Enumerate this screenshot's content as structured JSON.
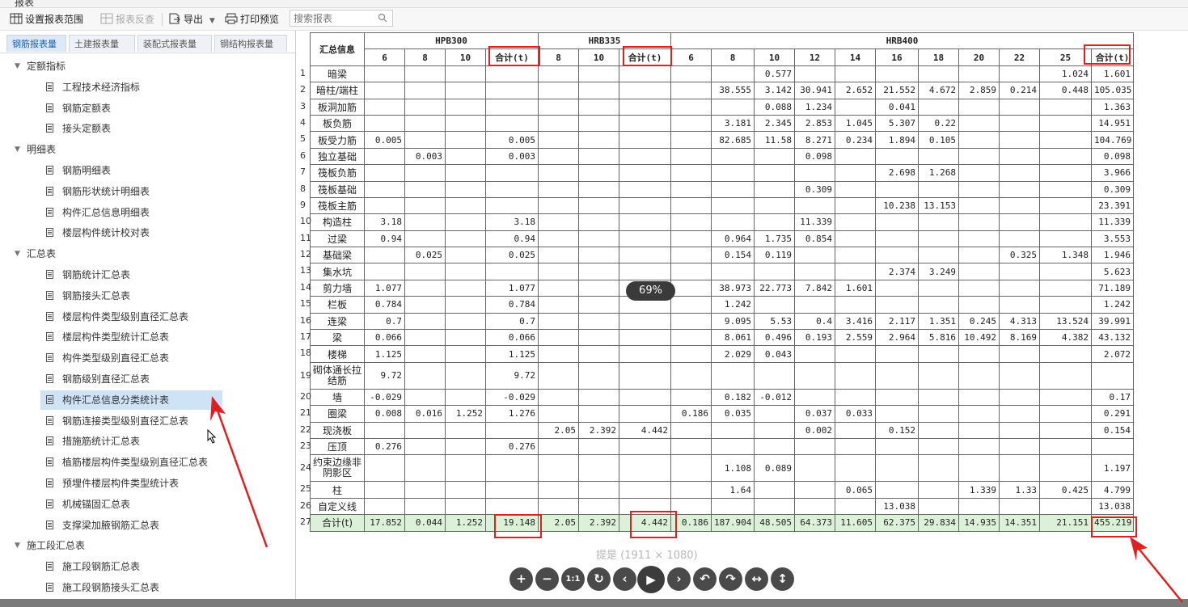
{
  "window": {
    "title": "报表"
  },
  "toolbar": {
    "set_range": "设置报表范围",
    "report_check": "报表反查",
    "export": "导出",
    "print_preview": "打印预览",
    "search_placeholder": "搜索报表"
  },
  "tabs": [
    {
      "label": "钢筋报表量",
      "active": true
    },
    {
      "label": "土建报表量",
      "active": false
    },
    {
      "label": "装配式报表量",
      "active": false
    },
    {
      "label": "钢结构报表量",
      "active": false
    }
  ],
  "tree": [
    {
      "type": "group",
      "label": "定额指标"
    },
    {
      "type": "leaf",
      "label": "工程技术经济指标"
    },
    {
      "type": "leaf",
      "label": "钢筋定额表"
    },
    {
      "type": "leaf",
      "label": "接头定额表"
    },
    {
      "type": "group",
      "label": "明细表"
    },
    {
      "type": "leaf",
      "label": "钢筋明细表"
    },
    {
      "type": "leaf",
      "label": "钢筋形状统计明细表"
    },
    {
      "type": "leaf",
      "label": "构件汇总信息明细表"
    },
    {
      "type": "leaf",
      "label": "楼层构件统计校对表"
    },
    {
      "type": "group",
      "label": "汇总表"
    },
    {
      "type": "leaf",
      "label": "钢筋统计汇总表"
    },
    {
      "type": "leaf",
      "label": "钢筋接头汇总表"
    },
    {
      "type": "leaf",
      "label": "楼层构件类型级别直径汇总表"
    },
    {
      "type": "leaf",
      "label": "楼层构件类型统计汇总表"
    },
    {
      "type": "leaf",
      "label": "构件类型级别直径汇总表"
    },
    {
      "type": "leaf",
      "label": "钢筋级别直径汇总表"
    },
    {
      "type": "leaf",
      "label": "构件汇总信息分类统计表",
      "selected": true
    },
    {
      "type": "leaf",
      "label": "钢筋连接类型级别直径汇总表"
    },
    {
      "type": "leaf",
      "label": "措施筋统计汇总表"
    },
    {
      "type": "leaf",
      "label": "植筋楼层构件类型级别直径汇总表"
    },
    {
      "type": "leaf",
      "label": "预埋件楼层构件类型统计表"
    },
    {
      "type": "leaf",
      "label": "机械锚固汇总表"
    },
    {
      "type": "leaf",
      "label": "支撑梁加腋钢筋汇总表"
    },
    {
      "type": "group",
      "label": "施工段汇总表"
    },
    {
      "type": "leaf",
      "label": "施工段钢筋汇总表"
    },
    {
      "type": "leaf",
      "label": "施工段钢筋接头汇总表"
    }
  ],
  "report": {
    "corner_header": "汇总信息",
    "groups": [
      {
        "name": "HPB300",
        "span": 4
      },
      {
        "name": "HRB335",
        "span": 3
      },
      {
        "name": "HRB400",
        "span": 11
      }
    ],
    "columns": [
      "6",
      "8",
      "10",
      "合计(t)",
      "8",
      "10",
      "合计(t)",
      "6",
      "8",
      "10",
      "12",
      "14",
      "16",
      "18",
      "20",
      "22",
      "25",
      "合计(t)"
    ],
    "rows": [
      {
        "n": "1",
        "name": "暗梁",
        "v": [
          "",
          "",
          "",
          "",
          "",
          "",
          "",
          "",
          "",
          "0.577",
          "",
          "",
          "",
          "",
          "",
          "",
          "1.024",
          "1.601"
        ]
      },
      {
        "n": "2",
        "name": "暗柱/端柱",
        "v": [
          "",
          "",
          "",
          "",
          "",
          "",
          "",
          "",
          "38.555",
          "3.142",
          "30.941",
          "2.652",
          "21.552",
          "4.672",
          "2.859",
          "0.214",
          "0.448",
          "105.035"
        ]
      },
      {
        "n": "3",
        "name": "板洞加筋",
        "v": [
          "",
          "",
          "",
          "",
          "",
          "",
          "",
          "",
          "",
          "0.088",
          "1.234",
          "",
          "0.041",
          "",
          "",
          "",
          "",
          "1.363"
        ]
      },
      {
        "n": "4",
        "name": "板负筋",
        "v": [
          "",
          "",
          "",
          "",
          "",
          "",
          "",
          "",
          "3.181",
          "2.345",
          "2.853",
          "1.045",
          "5.307",
          "0.22",
          "",
          "",
          "",
          "14.951"
        ]
      },
      {
        "n": "5",
        "name": "板受力筋",
        "v": [
          "0.005",
          "",
          "",
          "0.005",
          "",
          "",
          "",
          "",
          "82.685",
          "11.58",
          "8.271",
          "0.234",
          "1.894",
          "0.105",
          "",
          "",
          "",
          "104.769"
        ]
      },
      {
        "n": "6",
        "name": "独立基础",
        "v": [
          "",
          "0.003",
          "",
          "0.003",
          "",
          "",
          "",
          "",
          "",
          "",
          "0.098",
          "",
          "",
          "",
          "",
          "",
          "",
          "0.098"
        ]
      },
      {
        "n": "7",
        "name": "筏板负筋",
        "v": [
          "",
          "",
          "",
          "",
          "",
          "",
          "",
          "",
          "",
          "",
          "",
          "",
          "2.698",
          "1.268",
          "",
          "",
          "",
          "3.966"
        ]
      },
      {
        "n": "8",
        "name": "筏板基础",
        "v": [
          "",
          "",
          "",
          "",
          "",
          "",
          "",
          "",
          "",
          "",
          "0.309",
          "",
          "",
          "",
          "",
          "",
          "",
          "0.309"
        ]
      },
      {
        "n": "9",
        "name": "筏板主筋",
        "v": [
          "",
          "",
          "",
          "",
          "",
          "",
          "",
          "",
          "",
          "",
          "",
          "",
          "10.238",
          "13.153",
          "",
          "",
          "",
          "23.391"
        ]
      },
      {
        "n": "10",
        "name": "构造柱",
        "v": [
          "3.18",
          "",
          "",
          "3.18",
          "",
          "",
          "",
          "",
          "",
          "",
          "11.339",
          "",
          "",
          "",
          "",
          "",
          "",
          "11.339"
        ]
      },
      {
        "n": "11",
        "name": "过梁",
        "v": [
          "0.94",
          "",
          "",
          "0.94",
          "",
          "",
          "",
          "",
          "0.964",
          "1.735",
          "0.854",
          "",
          "",
          "",
          "",
          "",
          "",
          "3.553"
        ]
      },
      {
        "n": "12",
        "name": "基础梁",
        "v": [
          "",
          "0.025",
          "",
          "0.025",
          "",
          "",
          "",
          "",
          "0.154",
          "0.119",
          "",
          "",
          "",
          "",
          "",
          "0.325",
          "1.348",
          "1.946"
        ]
      },
      {
        "n": "13",
        "name": "集水坑",
        "v": [
          "",
          "",
          "",
          "",
          "",
          "",
          "",
          "",
          "",
          "",
          "",
          "",
          "2.374",
          "3.249",
          "",
          "",
          "",
          "5.623"
        ]
      },
      {
        "n": "14",
        "name": "剪力墙",
        "v": [
          "1.077",
          "",
          "",
          "1.077",
          "",
          "",
          "",
          "",
          "38.973",
          "22.773",
          "7.842",
          "1.601",
          "",
          "",
          "",
          "",
          "",
          "71.189"
        ]
      },
      {
        "n": "15",
        "name": "栏板",
        "v": [
          "0.784",
          "",
          "",
          "0.784",
          "",
          "",
          "",
          "",
          "1.242",
          "",
          "",
          "",
          "",
          "",
          "",
          "",
          "",
          "1.242"
        ]
      },
      {
        "n": "16",
        "name": "连梁",
        "v": [
          "0.7",
          "",
          "",
          "0.7",
          "",
          "",
          "",
          "",
          "9.095",
          "5.53",
          "0.4",
          "3.416",
          "2.117",
          "1.351",
          "0.245",
          "4.313",
          "13.524",
          "39.991"
        ]
      },
      {
        "n": "17",
        "name": "梁",
        "v": [
          "0.066",
          "",
          "",
          "0.066",
          "",
          "",
          "",
          "",
          "8.061",
          "0.496",
          "0.193",
          "2.559",
          "2.964",
          "5.816",
          "10.492",
          "8.169",
          "4.382",
          "43.132"
        ]
      },
      {
        "n": "18",
        "name": "楼梯",
        "v": [
          "1.125",
          "",
          "",
          "1.125",
          "",
          "",
          "",
          "",
          "2.029",
          "0.043",
          "",
          "",
          "",
          "",
          "",
          "",
          "",
          "2.072"
        ]
      },
      {
        "n": "19",
        "name": "砌体通长拉结筋",
        "v": [
          "9.72",
          "",
          "",
          "9.72",
          "",
          "",
          "",
          "",
          "",
          "",
          "",
          "",
          "",
          "",
          "",
          "",
          "",
          ""
        ],
        "tall": true
      },
      {
        "n": "20",
        "name": "墙",
        "v": [
          "-0.029",
          "",
          "",
          "-0.029",
          "",
          "",
          "",
          "",
          "0.182",
          "-0.012",
          "",
          "",
          "",
          "",
          "",
          "",
          "",
          "0.17"
        ]
      },
      {
        "n": "21",
        "name": "圈梁",
        "v": [
          "0.008",
          "0.016",
          "1.252",
          "1.276",
          "",
          "",
          "",
          "0.186",
          "0.035",
          "",
          "0.037",
          "0.033",
          "",
          "",
          "",
          "",
          "",
          "0.291"
        ]
      },
      {
        "n": "22",
        "name": "现浇板",
        "v": [
          "",
          "",
          "",
          "",
          "2.05",
          "2.392",
          "4.442",
          "",
          "",
          "",
          "0.002",
          "",
          "0.152",
          "",
          "",
          "",
          "",
          "0.154"
        ]
      },
      {
        "n": "23",
        "name": "压顶",
        "v": [
          "0.276",
          "",
          "",
          "0.276",
          "",
          "",
          "",
          "",
          "",
          "",
          "",
          "",
          "",
          "",
          "",
          "",
          "",
          ""
        ]
      },
      {
        "n": "24",
        "name": "约束边缘非阴影区",
        "v": [
          "",
          "",
          "",
          "",
          "",
          "",
          "",
          "",
          "1.108",
          "0.089",
          "",
          "",
          "",
          "",
          "",
          "",
          "",
          "1.197"
        ],
        "tall": true
      },
      {
        "n": "25",
        "name": "柱",
        "v": [
          "",
          "",
          "",
          "",
          "",
          "",
          "",
          "",
          "1.64",
          "",
          "",
          "0.065",
          "",
          "",
          "1.339",
          "1.33",
          "0.425",
          "4.799"
        ]
      },
      {
        "n": "26",
        "name": "自定义线",
        "v": [
          "",
          "",
          "",
          "",
          "",
          "",
          "",
          "",
          "",
          "",
          "",
          "",
          "13.038",
          "",
          "",
          "",
          "",
          "13.038"
        ]
      }
    ],
    "total": {
      "n": "27",
      "name": "合计(t)",
      "v": [
        "17.852",
        "0.044",
        "1.252",
        "19.148",
        "2.05",
        "2.392",
        "4.442",
        "0.186",
        "187.904",
        "48.505",
        "64.373",
        "11.605",
        "62.375",
        "29.834",
        "14.935",
        "14.351",
        "21.151",
        "455.219"
      ]
    }
  },
  "viewer": {
    "zoom": "69%",
    "caption": "提是 (1911 × 1080)",
    "buttons": [
      {
        "name": "zoom-in-icon",
        "glyph": "+"
      },
      {
        "name": "zoom-out-icon",
        "glyph": "−"
      },
      {
        "name": "actual-size-icon",
        "glyph": "1:1"
      },
      {
        "name": "reset-icon",
        "glyph": "↻"
      },
      {
        "name": "prev-icon",
        "glyph": "‹"
      },
      {
        "name": "play-icon",
        "glyph": "▶"
      },
      {
        "name": "next-icon",
        "glyph": "›"
      },
      {
        "name": "rotate-left-icon",
        "glyph": "↶"
      },
      {
        "name": "rotate-right-icon",
        "glyph": "↷"
      },
      {
        "name": "flip-horizontal-icon",
        "glyph": "↔"
      },
      {
        "name": "flip-vertical-icon",
        "glyph": "↕"
      }
    ]
  },
  "colors": {
    "highlight": "#e02020",
    "total_row": "#dcf2d8",
    "selected_row": "#cfe3f7"
  }
}
